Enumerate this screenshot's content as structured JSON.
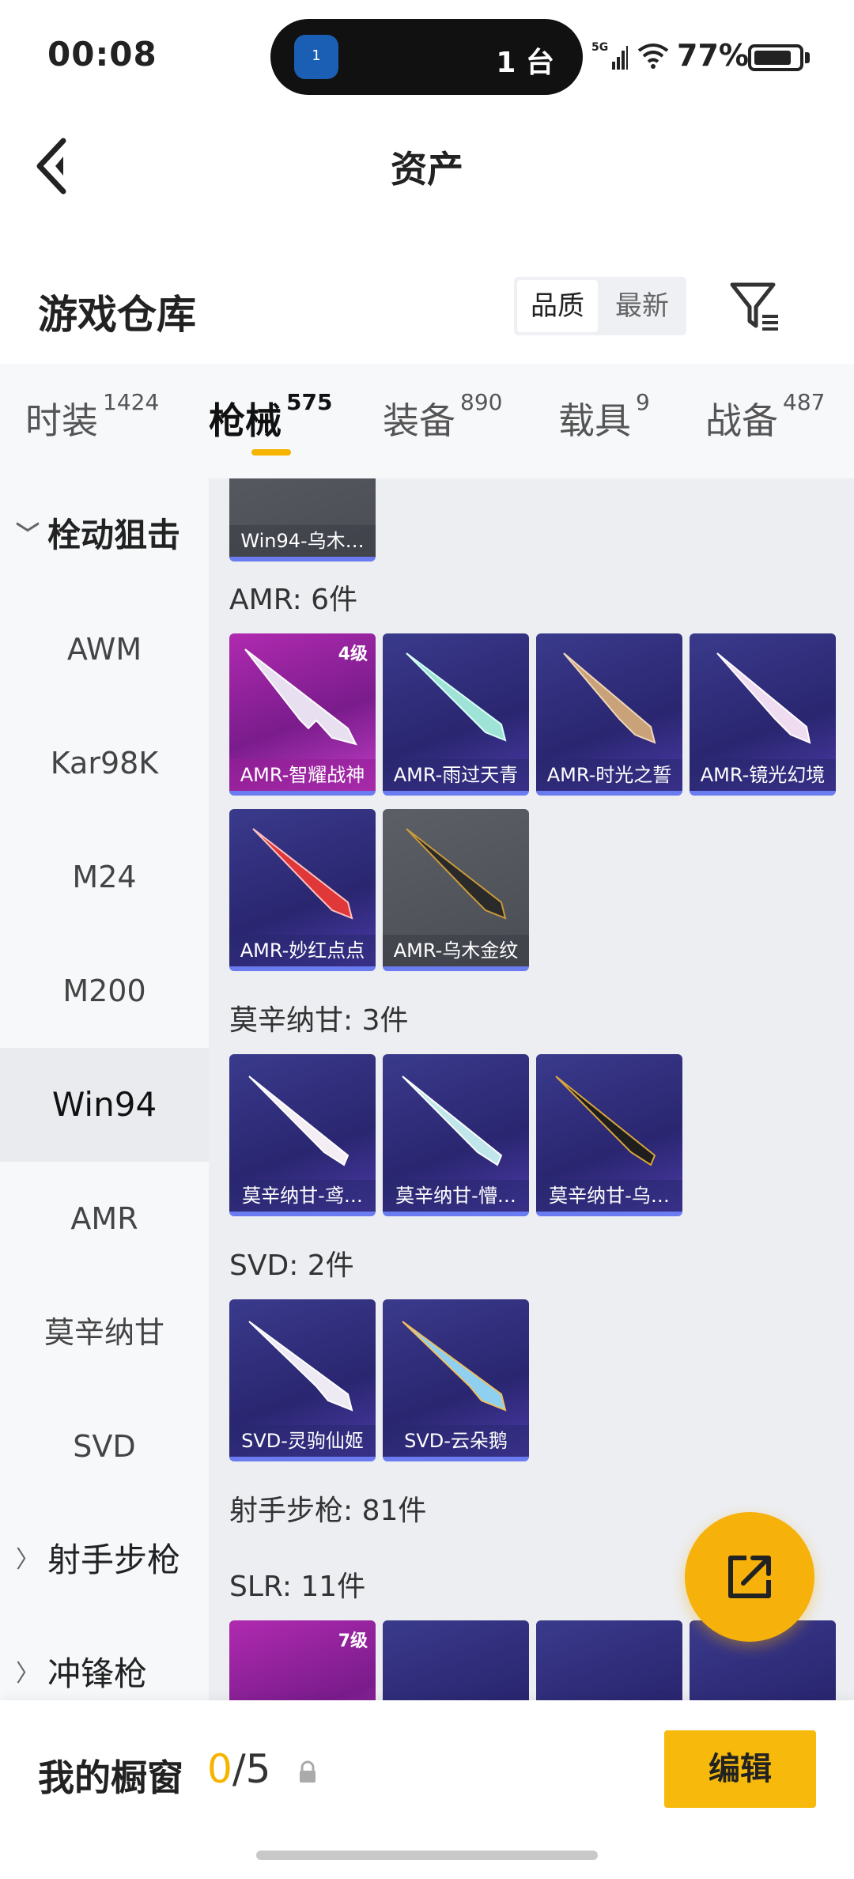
{
  "status_bar": {
    "time": "00:08",
    "island_text": "1 台",
    "island_app_badge": "1",
    "signal_label": "5G",
    "battery_pct": "77%"
  },
  "header": {
    "title": "资产"
  },
  "warehouse": {
    "title": "游戏仓库",
    "sort_quality": "品质",
    "sort_latest": "最新"
  },
  "tabs": [
    {
      "label": "时装",
      "count": "1424"
    },
    {
      "label": "枪械",
      "count": "575"
    },
    {
      "label": "装备",
      "count": "890"
    },
    {
      "label": "载具",
      "count": "9"
    },
    {
      "label": "战备",
      "count": "487"
    }
  ],
  "sidebar": {
    "group_open": "栓动狙击",
    "items": [
      "AWM",
      "Kar98K",
      "M24",
      "M200",
      "Win94",
      "AMR",
      "莫辛纳甘",
      "SVD"
    ],
    "group_2": "射手步枪",
    "group_3": "冲锋枪"
  },
  "content": {
    "top_partial": "Win94-乌木…",
    "amr_label": "AMR: 6件",
    "amr": [
      "AMR-智耀战神",
      "AMR-雨过天青",
      "AMR-时光之誓",
      "AMR-镜光幻境",
      "AMR-妙红点点",
      "AMR-乌木金纹"
    ],
    "amr_level": "4级",
    "mosin_label": "莫辛纳甘: 3件",
    "mosin": [
      "莫辛纳甘-鸢…",
      "莫辛纳甘-懵…",
      "莫辛纳甘-乌…"
    ],
    "svd_label": "SVD: 2件",
    "svd": [
      "SVD-灵驹仙姬",
      "SVD-云朵鹅"
    ],
    "dmr_label": "射手步枪: 81件",
    "slr_label": "SLR: 11件",
    "slr_level": "7级"
  },
  "bottom": {
    "showcase": "我的橱窗",
    "count_num": "0",
    "count_total": "/5",
    "edit": "编辑"
  }
}
